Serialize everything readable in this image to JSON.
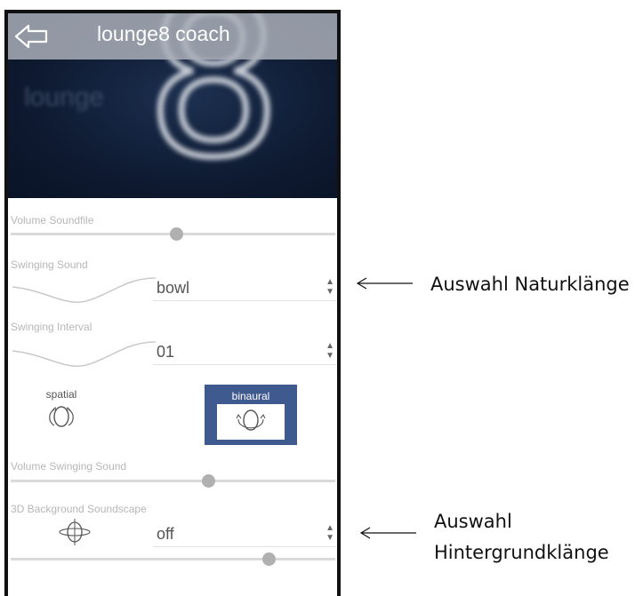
{
  "app": {
    "title": "lounge8 coach",
    "hero_brand": "lounge",
    "hero_digit": "8"
  },
  "volume_soundfile": {
    "label": "Volume Soundfile",
    "value": 0.5
  },
  "swinging_sound": {
    "label": "Swinging Sound",
    "selected": "bowl"
  },
  "swinging_interval": {
    "label": "Swinging Interval",
    "selected": "01"
  },
  "modes": {
    "spatial": "spatial",
    "binaural": "binaural",
    "active": "binaural",
    "active_color": "#3f5a8f"
  },
  "volume_swinging": {
    "label": "Volume Swinging Sound",
    "value": 0.6
  },
  "background": {
    "label": "3D Background Soundscape",
    "selected": "off",
    "volume_value": 0.78
  },
  "annotations": {
    "naturklaenge": "Auswahl Naturklänge",
    "hintergrund_line1": "Auswahl",
    "hintergrund_line2": "Hintergrundklänge"
  }
}
